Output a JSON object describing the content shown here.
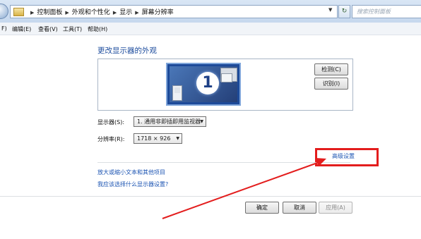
{
  "address_bar": {
    "crumbs": [
      "控制面板",
      "外观和个性化",
      "显示",
      "屏幕分辨率"
    ],
    "search_placeholder": "搜索控制面板"
  },
  "menu": {
    "items": [
      "F)",
      "编辑(E)",
      "查看(V)",
      "工具(T)",
      "帮助(H)"
    ]
  },
  "page": {
    "title": "更改显示器的外观",
    "monitor_number": "1",
    "detect_button": "检测(C)",
    "identify_button": "识别(I)",
    "display_label": "显示器(S):",
    "display_value": "1. 通用非即插即用监视器",
    "resolution_label": "分辨率(R):",
    "resolution_value": "1718 × 926",
    "advanced_link": "高级设置",
    "link_text_size": "放大或缩小文本和其他项目",
    "link_which_settings": "我应该选择什么显示器设置?"
  },
  "footer": {
    "ok": "确定",
    "cancel": "取消",
    "apply": "应用(A)"
  },
  "colors": {
    "annotation": "#e31d1d",
    "link": "#1d55b3",
    "title": "#1e4d9e"
  }
}
